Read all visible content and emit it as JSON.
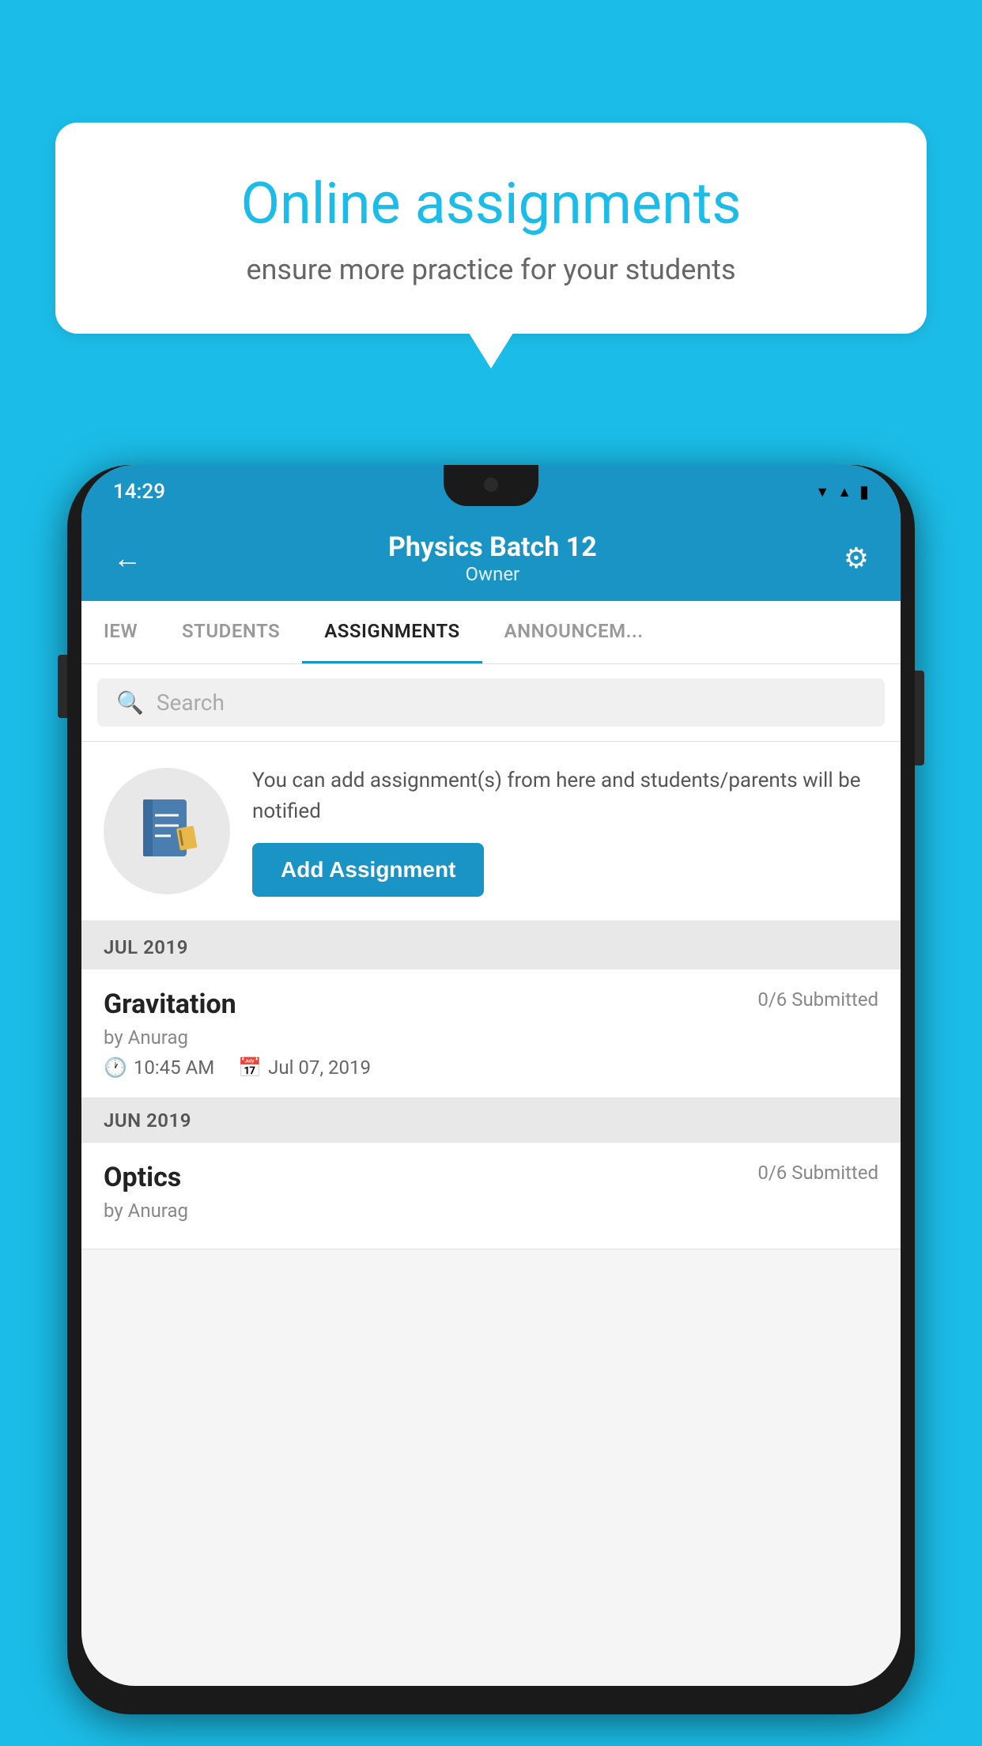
{
  "background": {
    "color": "#1BBDE8"
  },
  "speech_bubble": {
    "title": "Online assignments",
    "subtitle": "ensure more practice for your students"
  },
  "status_bar": {
    "time": "14:29",
    "wifi": "wifi-icon",
    "signal": "signal-icon",
    "battery": "battery-icon"
  },
  "header": {
    "back_label": "←",
    "title": "Physics Batch 12",
    "subtitle": "Owner",
    "gear_label": "⚙"
  },
  "tabs": [
    {
      "label": "IEW",
      "active": false
    },
    {
      "label": "STUDENTS",
      "active": false
    },
    {
      "label": "ASSIGNMENTS",
      "active": true
    },
    {
      "label": "ANNOUNCEM...",
      "active": false
    }
  ],
  "search": {
    "placeholder": "Search",
    "icon": "search-icon"
  },
  "info_banner": {
    "notebook_icon": "📓",
    "description": "You can add assignment(s) from here and students/parents will be notified",
    "button_label": "Add Assignment"
  },
  "sections": [
    {
      "month_label": "JUL 2019",
      "assignments": [
        {
          "name": "Gravitation",
          "submitted": "0/6 Submitted",
          "by": "by Anurag",
          "time": "10:45 AM",
          "date": "Jul 07, 2019"
        }
      ]
    },
    {
      "month_label": "JUN 2019",
      "assignments": [
        {
          "name": "Optics",
          "submitted": "0/6 Submitted",
          "by": "by Anurag",
          "time": "",
          "date": ""
        }
      ]
    }
  ]
}
